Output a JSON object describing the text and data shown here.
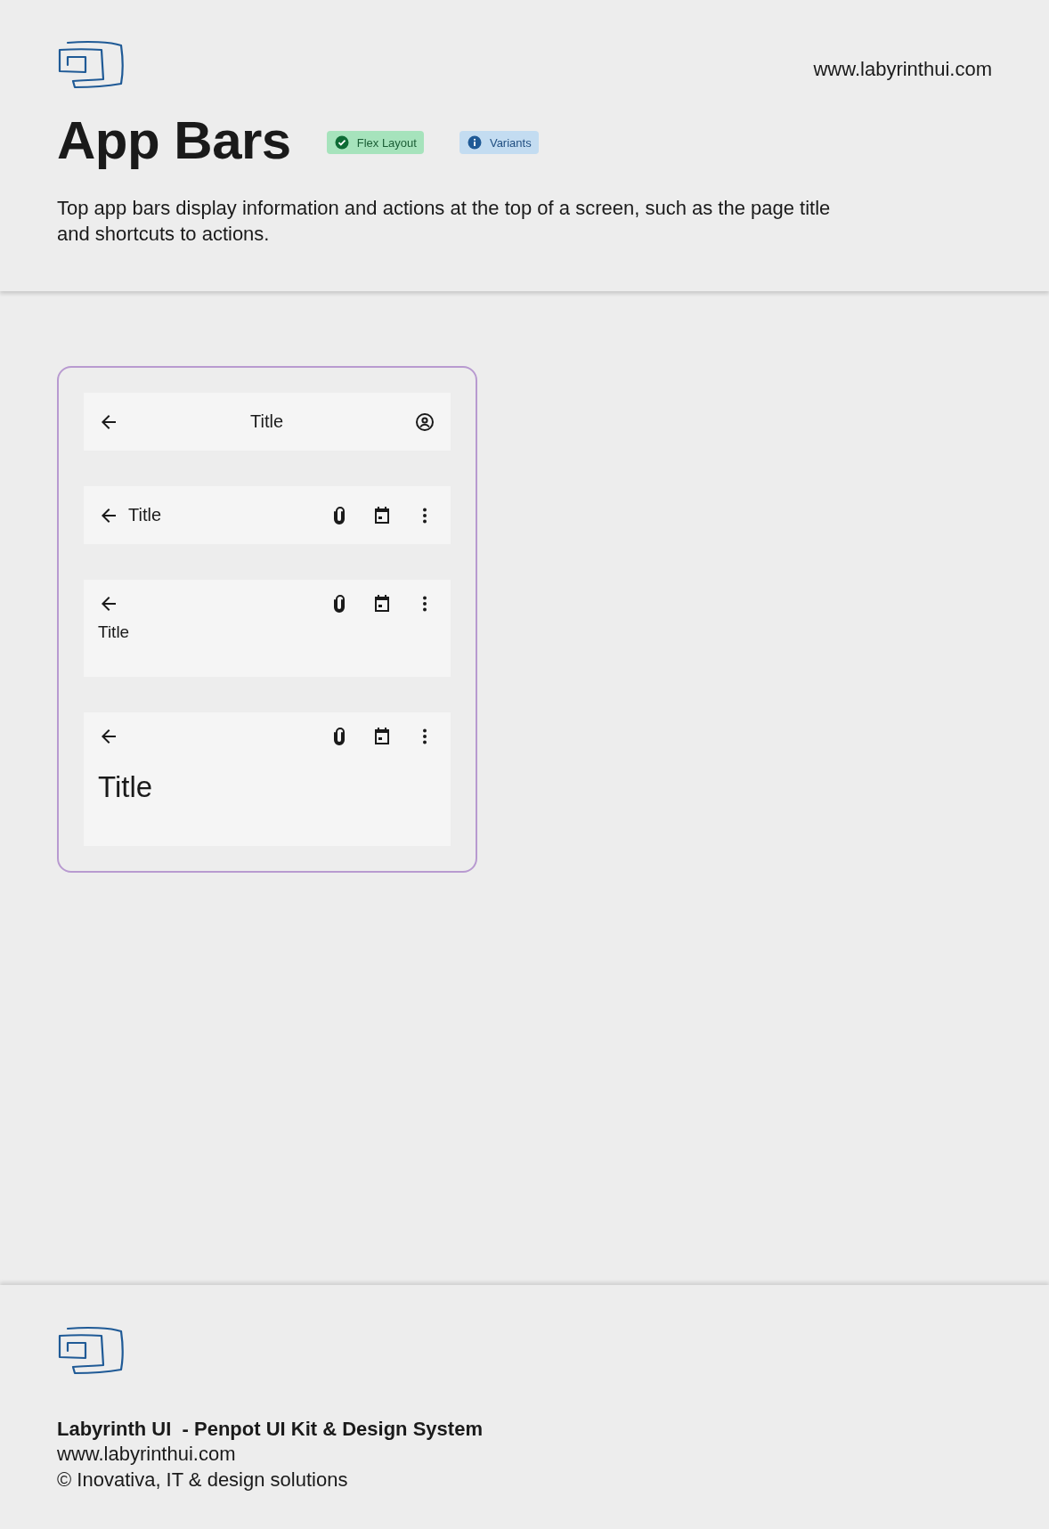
{
  "header": {
    "url": "www.labyrinthui.com",
    "title": "App Bars",
    "badges": [
      {
        "kind": "success",
        "label": "Flex Layout"
      },
      {
        "kind": "info",
        "label": "Variants"
      }
    ],
    "description": "Top app bars display information and actions at the top of a screen, such as the page title and shortcuts to actions."
  },
  "app_bars": [
    {
      "kind": "center",
      "title": "Title"
    },
    {
      "kind": "small",
      "title": "Title"
    },
    {
      "kind": "medium",
      "title": "Title"
    },
    {
      "kind": "large",
      "title": "Title"
    }
  ],
  "footer": {
    "heading": "Labyrinth UI  - Penpot UI Kit & Design System",
    "url": "www.labyrinthui.com",
    "copyright": "© Inovativa, IT & design solutions"
  }
}
